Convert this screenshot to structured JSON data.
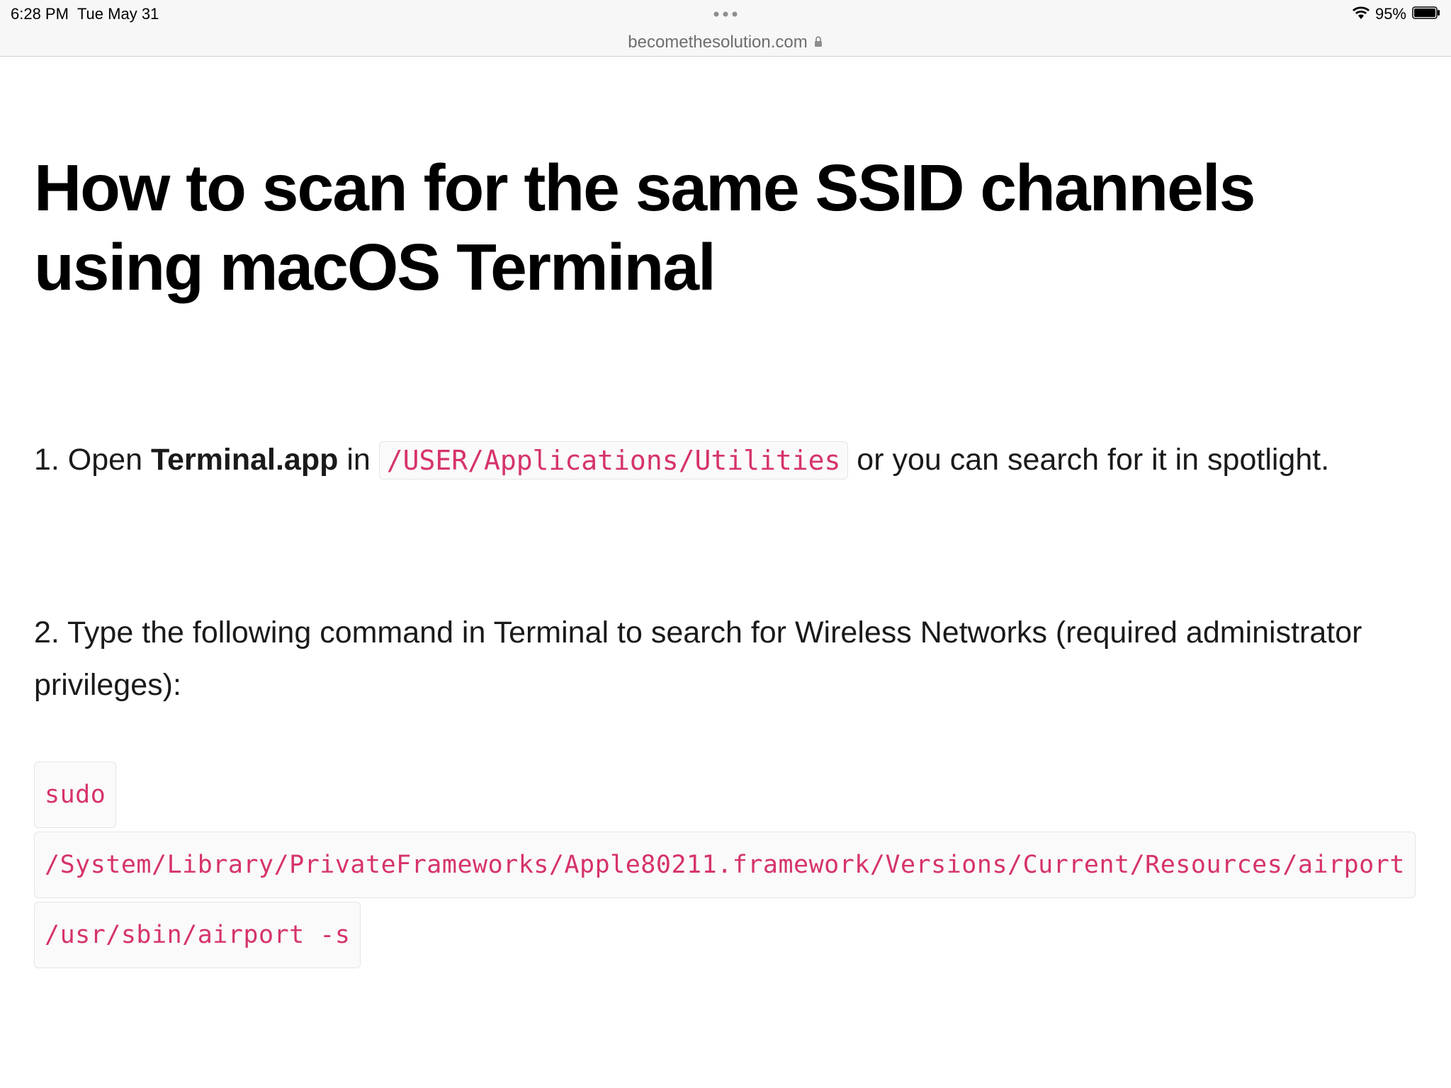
{
  "status": {
    "time": "6:28 PM",
    "date": "Tue May 31",
    "battery_pct": "95%"
  },
  "browser": {
    "url": "becomethesolution.com"
  },
  "article": {
    "title": "How to scan for the same SSID channels using macOS Terminal",
    "step1": {
      "prefix": "1. Open ",
      "app_name": "Terminal.app",
      "mid": " in ",
      "path": "/USER/Applications/Utilities",
      "suffix": " or you can search for it in spotlight."
    },
    "step2": {
      "text": "2. Type the following command in Terminal to search for Wireless Networks (required administrator privileges):"
    },
    "code": {
      "line1": "sudo",
      "line2": "/System/Library/PrivateFrameworks/Apple80211.framework/Versions/Current/Resources/airport",
      "line3": "/usr/sbin/airport -s"
    }
  }
}
